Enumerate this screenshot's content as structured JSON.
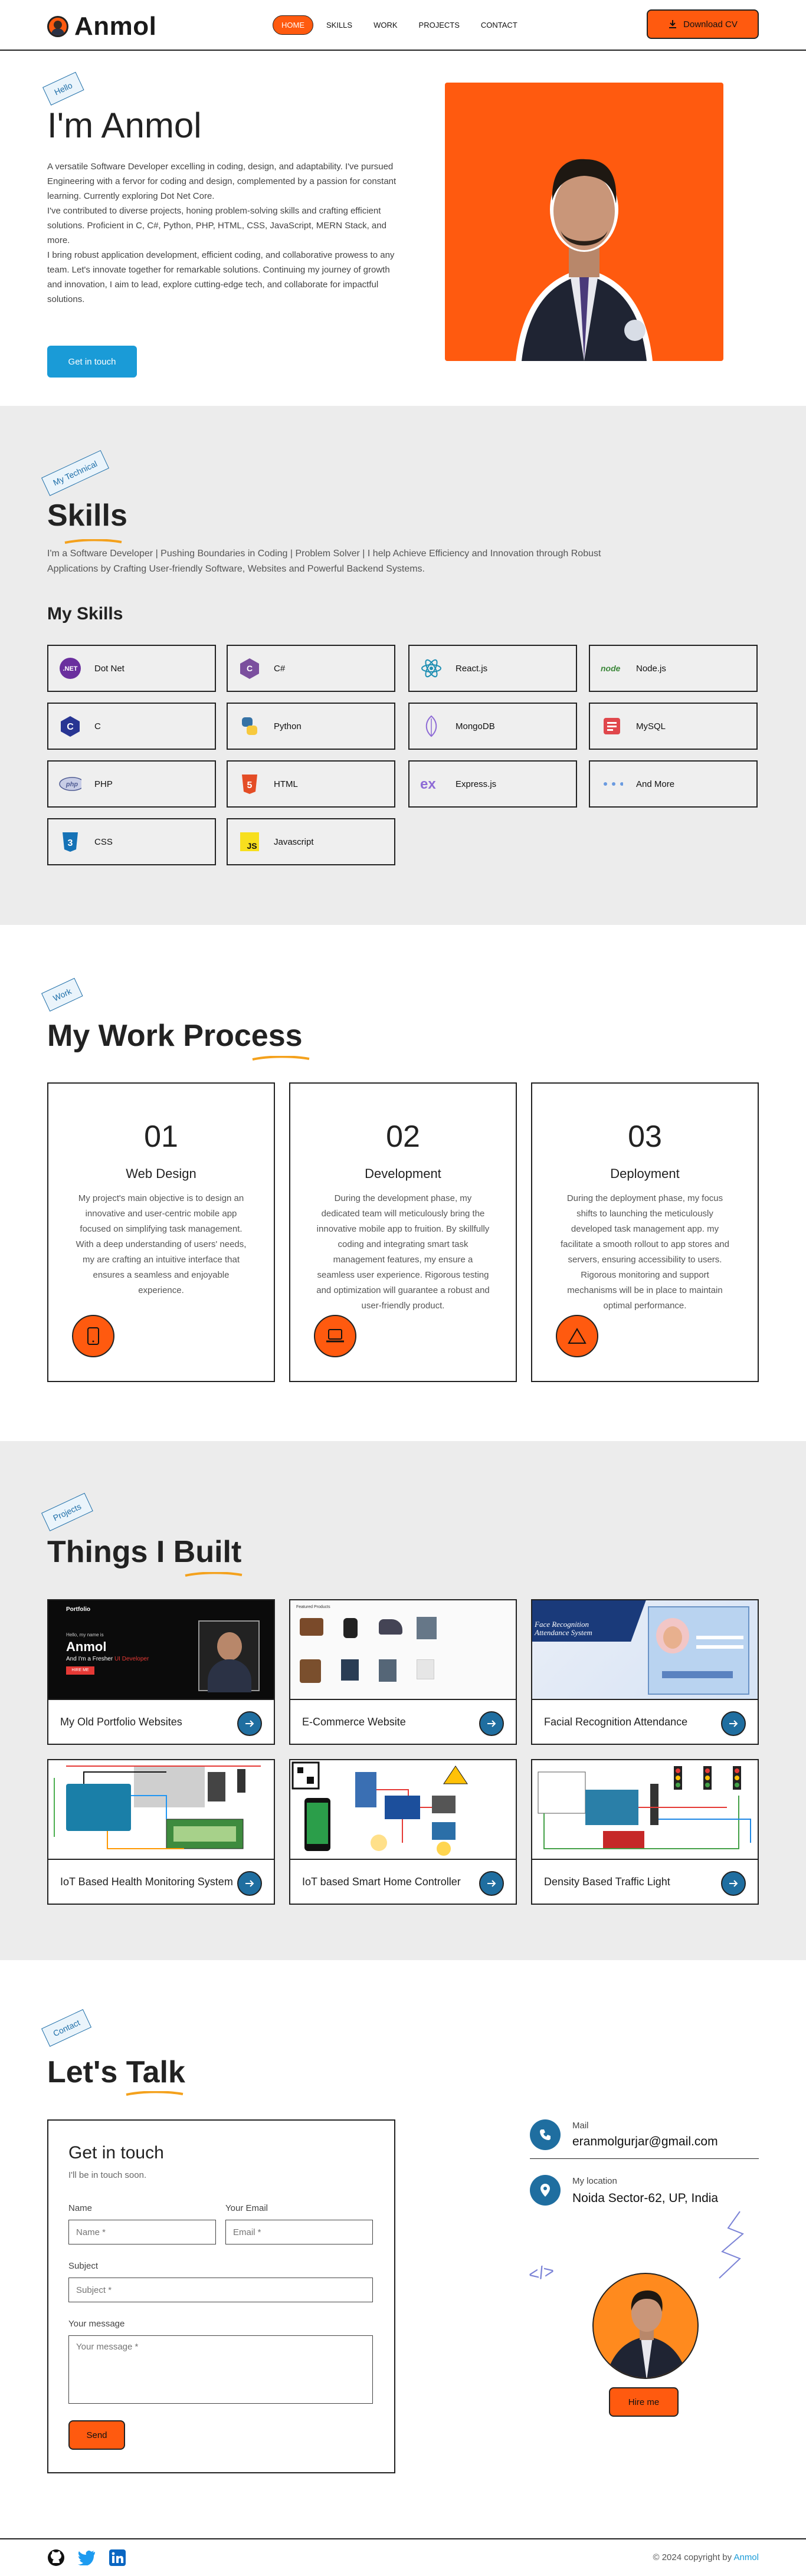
{
  "header": {
    "logo_text": "Anmol",
    "nav": [
      {
        "label": "HOME",
        "active": true
      },
      {
        "label": "SKILLS",
        "active": false
      },
      {
        "label": "WORK",
        "active": false
      },
      {
        "label": "PROJECTS",
        "active": false
      },
      {
        "label": "CONTACT",
        "active": false
      }
    ],
    "download_label": "Download CV"
  },
  "hero": {
    "tag": "Hello",
    "title": "I'm Anmol",
    "paragraph": "A versatile Software Developer excelling in coding, design, and adaptability. I've pursued Engineering with a fervor for coding and design, complemented by a passion for constant learning. Currently exploring Dot Net Core.\nI've contributed to diverse projects, honing problem-solving skills and crafting efficient solutions. Proficient in C, C#, Python, PHP, HTML, CSS, JavaScript, MERN Stack, and more.\nI bring robust application development, efficient coding, and collaborative prowess to any team. Let's innovate together for remarkable solutions. Continuing my journey of growth and innovation, I aim to lead, explore cutting-edge tech, and collaborate for impactful solutions.",
    "cta": "Get in touch"
  },
  "skills": {
    "tag": "My Technical",
    "title": "Skills",
    "subtitle": "I'm a Software Developer | Pushing Boundaries in Coding | Problem Solver | I help Achieve Efficiency and Innovation through Robust Applications by Crafting User-friendly Software, Websites and Powerful Backend Systems.",
    "list_title": "My Skills",
    "items": [
      {
        "label": "Dot Net",
        "icon": "dotnet-icon"
      },
      {
        "label": "C#",
        "icon": "csharp-icon"
      },
      {
        "label": "React.js",
        "icon": "react-icon"
      },
      {
        "label": "Node.js",
        "icon": "nodejs-icon"
      },
      {
        "label": "C",
        "icon": "c-icon"
      },
      {
        "label": "Python",
        "icon": "python-icon"
      },
      {
        "label": "MongoDB",
        "icon": "mongodb-icon"
      },
      {
        "label": "MySQL",
        "icon": "mysql-icon"
      },
      {
        "label": "PHP",
        "icon": "php-icon"
      },
      {
        "label": "HTML",
        "icon": "html-icon"
      },
      {
        "label": "Express.js",
        "icon": "express-icon"
      },
      {
        "label": "And More",
        "icon": "more-icon"
      },
      {
        "label": "CSS",
        "icon": "css-icon"
      },
      {
        "label": "Javascript",
        "icon": "javascript-icon"
      }
    ]
  },
  "work": {
    "tag": "Work",
    "title": "My Work Process",
    "steps": [
      {
        "num": "01",
        "title": "Web Design",
        "text": "My project's main objective is to design an innovative and user-centric mobile app focused on simplifying task management. With a deep understanding of users' needs, my are crafting an intuitive interface that ensures a seamless and enjoyable experience.",
        "icon": "mobile-icon"
      },
      {
        "num": "02",
        "title": "Development",
        "text": "During the development phase, my dedicated team will meticulously bring the innovative mobile app to fruition. By skillfully coding and integrating smart task management features, my ensure a seamless user experience. Rigorous testing and optimization will guarantee a robust and user-friendly product.",
        "icon": "laptop-icon"
      },
      {
        "num": "03",
        "title": "Deployment",
        "text": "During the deployment phase, my focus shifts to launching the meticulously developed task management app. my facilitate a smooth rollout to app stores and servers, ensuring accessibility to users. Rigorous monitoring and support mechanisms will be in place to maintain optimal performance.",
        "icon": "warning-icon"
      }
    ]
  },
  "projects": {
    "tag": "Projects",
    "title": "Things I Built",
    "items": [
      {
        "title": "My Old Portfolio Websites",
        "thumb": {
          "brand": "Portfolio",
          "greeting": "Hello, my name is",
          "name": "Anmol",
          "role": "And I'm a Fresher",
          "role_accent": "UI Developer",
          "cta": "HIRE ME"
        }
      },
      {
        "title": "E-Commerce Website",
        "thumb": {
          "header": "Featured Products"
        }
      },
      {
        "title": "Facial Recognition Attendance",
        "thumb": {
          "caption": "Face Recognition Attendance System"
        }
      },
      {
        "title": "IoT Based Health Monitoring System",
        "thumb": {}
      },
      {
        "title": "IoT based Smart Home Controller",
        "thumb": {}
      },
      {
        "title": "Density Based Traffic Light",
        "thumb": {}
      }
    ]
  },
  "contact": {
    "tag": "Contact",
    "title": "Let's Talk",
    "form": {
      "title": "Get in touch",
      "subtitle": "I'll be in touch soon.",
      "name_label": "Name",
      "name_placeholder": "Name *",
      "email_label": "Your Email",
      "email_placeholder": "Email *",
      "subject_label": "Subject",
      "subject_placeholder": "Subject *",
      "message_label": "Your message",
      "message_placeholder": "Your message *",
      "send": "Send"
    },
    "mail_label": "Mail",
    "mail_value": "eranmolgurjar@gmail.com",
    "location_label": "My location",
    "location_value": "Noida Sector-62, UP, India",
    "code_symbol": "</>",
    "hire": "Hire me"
  },
  "footer": {
    "copyright": "© 2024 copyright by",
    "brand": "Anmol",
    "socials": [
      "github-icon",
      "twitter-icon",
      "linkedin-icon"
    ]
  },
  "colors": {
    "accent": "#ff5a0f",
    "primary": "#1a9bd7",
    "dark_blue": "#1f6ea0",
    "section_bg": "#ececec"
  }
}
